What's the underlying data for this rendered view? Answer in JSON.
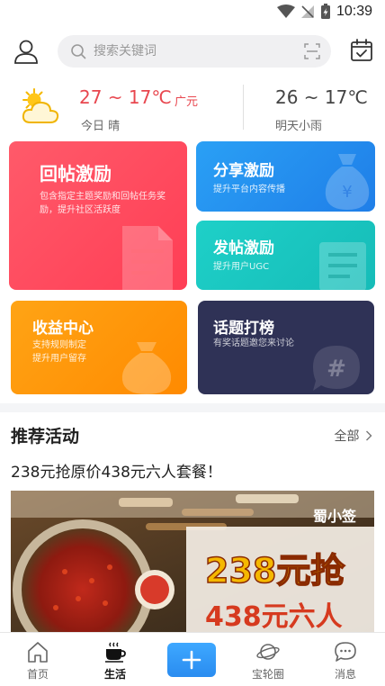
{
  "status_bar": {
    "time": "10:39"
  },
  "header": {
    "search_placeholder": "搜索关键词"
  },
  "weather": {
    "today": {
      "temp": "27 ~ 17℃",
      "city": "广元",
      "label": "今日",
      "condition": "晴"
    },
    "tomorrow": {
      "temp": "26 ~ 17℃",
      "desc": "明天小雨"
    },
    "icon": "sun-cloud-icon"
  },
  "cards": {
    "reply": {
      "title": "回帖激励",
      "desc": "包含指定主题奖励和回帖任务奖励，提升社区活跃度",
      "color": "#ff4a5e"
    },
    "share": {
      "title": "分享激励",
      "desc": "提升平台内容传播",
      "color": "#2690f0"
    },
    "post": {
      "title": "发帖激励",
      "desc": "提升用户UGC",
      "color": "#1ac7c0"
    },
    "income": {
      "title": "收益中心",
      "desc_line1": "支持规则制定",
      "desc_line2": "提升用户留存",
      "color": "#ff9a0a"
    },
    "topic": {
      "title": "话题打榜",
      "desc": "有奖话题邀您来讨论",
      "color": "#2f3256"
    }
  },
  "recommended": {
    "title": "推荐活动",
    "all_label": "全部",
    "event": {
      "title": "238元抢原价438元六人套餐！",
      "image_brand": "蜀小签",
      "image_line1": "238元抢",
      "image_line2": "438元六人"
    }
  },
  "bottom_nav": {
    "items": [
      {
        "label": "首页",
        "icon": "home-icon"
      },
      {
        "label": "生活",
        "icon": "coffee-cup-icon",
        "active": true
      },
      {
        "label": "",
        "icon": "plus-icon"
      },
      {
        "label": "宝轮圈",
        "icon": "planet-icon"
      },
      {
        "label": "消息",
        "icon": "chat-bubble-icon"
      }
    ]
  },
  "colors": {
    "accent": "#2a8cf0",
    "temp_today": "#e8474f"
  }
}
